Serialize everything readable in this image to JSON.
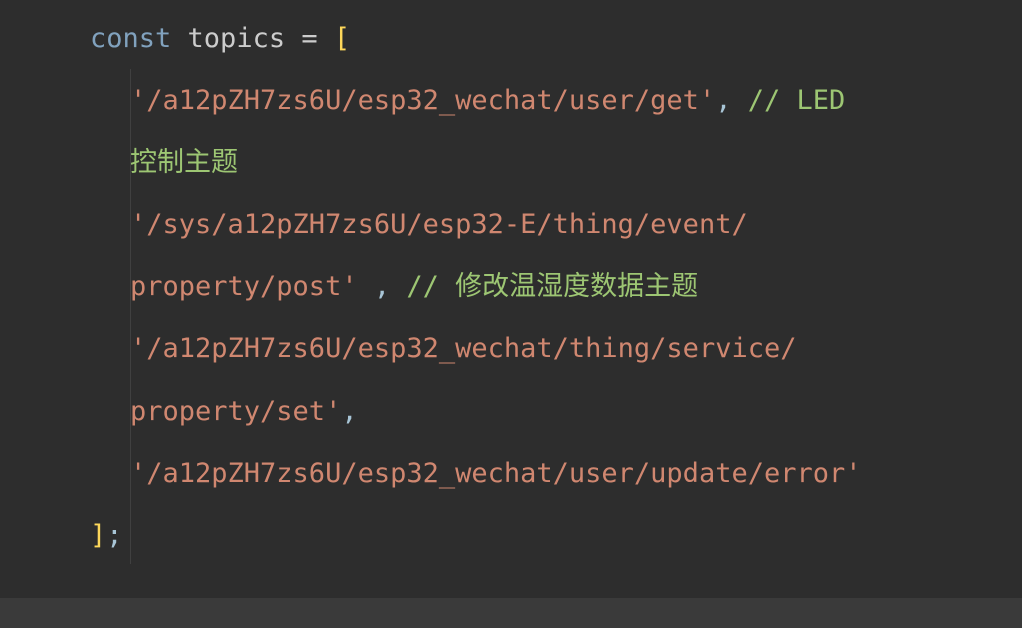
{
  "code": {
    "line1": {
      "keyword": "const",
      "variable": "topics",
      "operator": "=",
      "bracket": "["
    },
    "line2": {
      "string": "'/a12pZH7zs6U/esp32_wechat/user/get'",
      "comma": ",",
      "comment": "// LED"
    },
    "line3": {
      "comment": "控制主题"
    },
    "line4": {
      "string": "'/sys/a12pZH7zs6U/esp32-E/thing/event/"
    },
    "line5": {
      "string": "property/post'",
      "comma": ",",
      "comment": "// 修改温湿度数据主题"
    },
    "line6": {
      "string": "'/a12pZH7zs6U/esp32_wechat/thing/service/"
    },
    "line7": {
      "string": "property/set'",
      "comma": ","
    },
    "line8": {
      "string": "'/a12pZH7zs6U/esp32_wechat/user/update/error'"
    },
    "line9": {
      "bracket": "]",
      "semicolon": ";"
    }
  }
}
